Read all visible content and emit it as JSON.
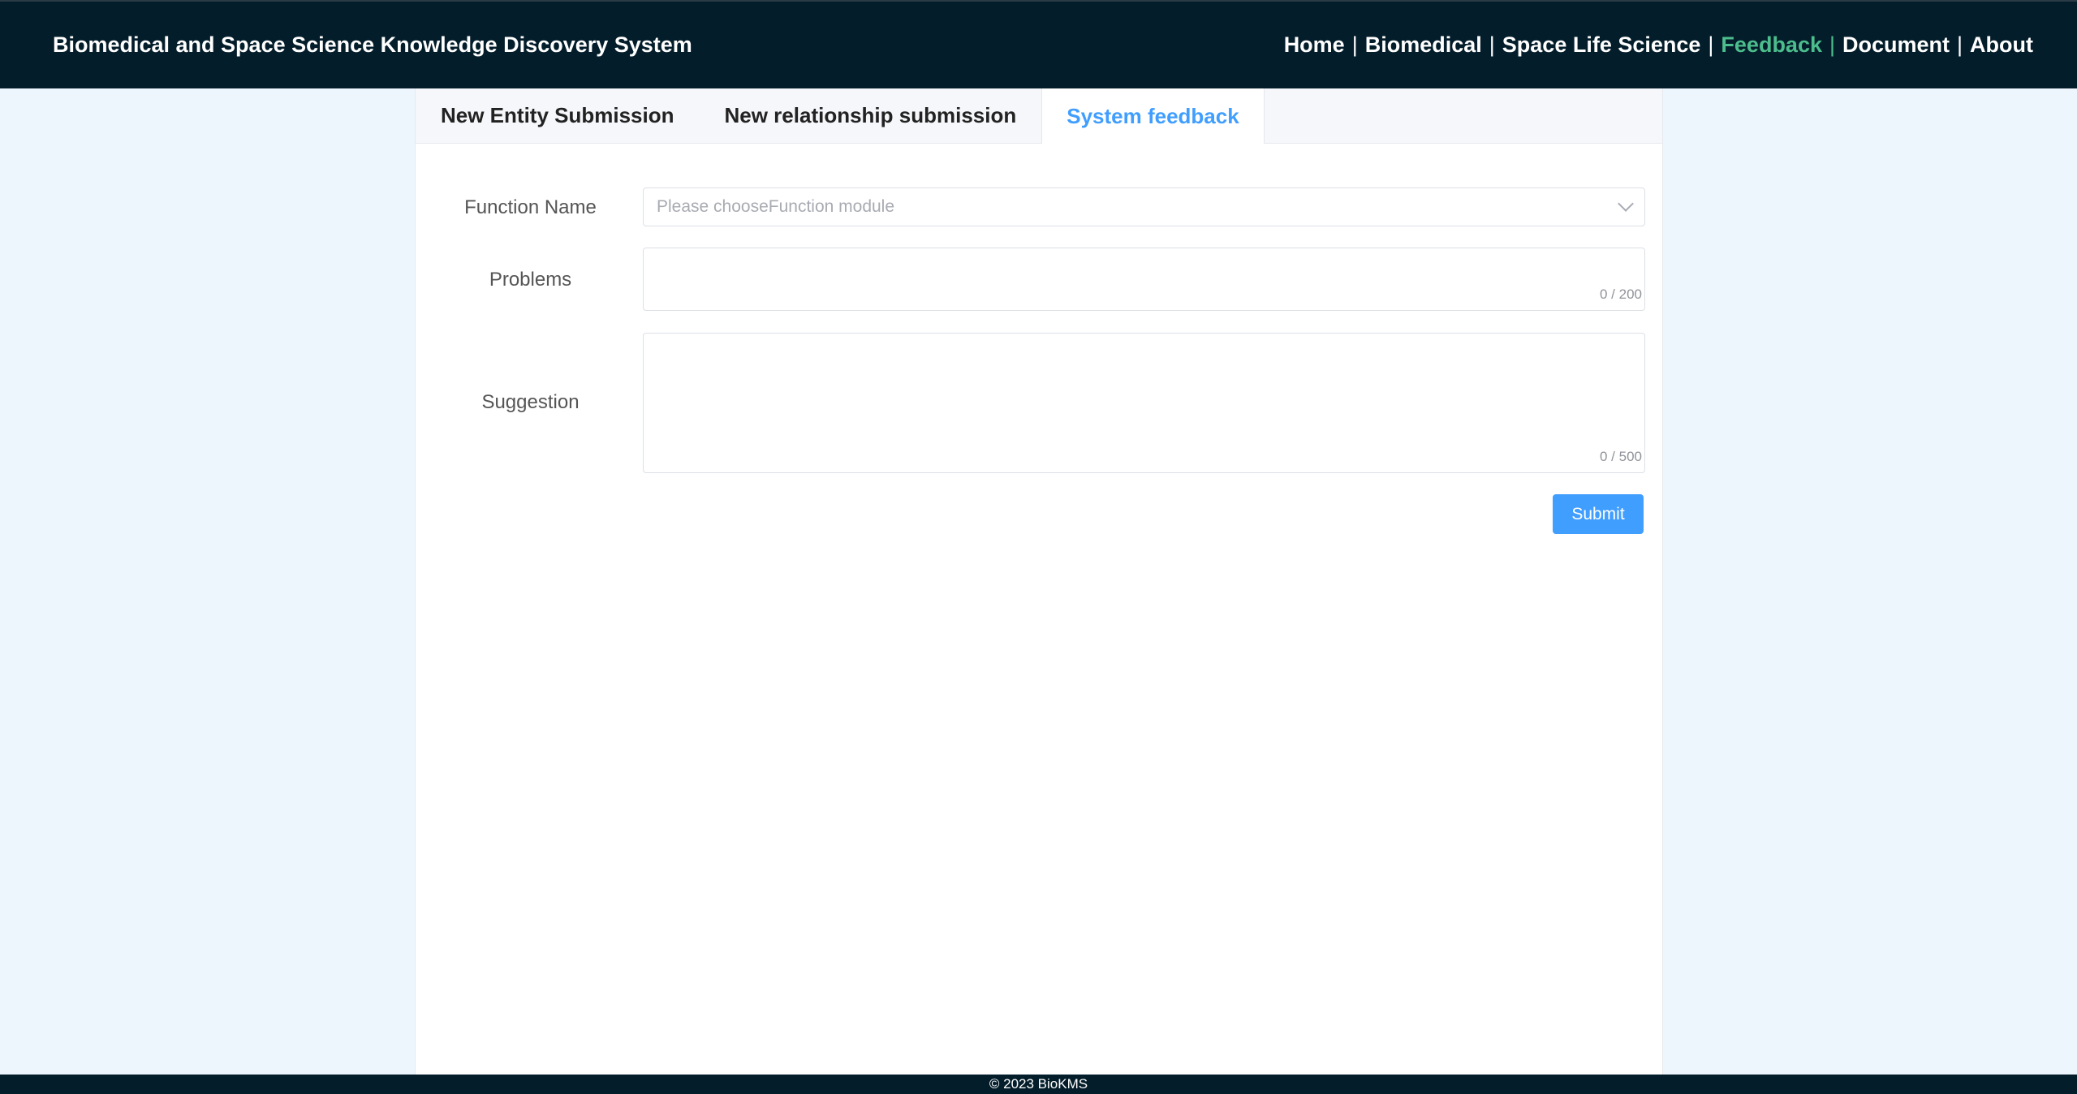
{
  "header": {
    "title": "Biomedical and Space Science Knowledge Discovery System",
    "nav": [
      {
        "label": "Home"
      },
      {
        "label": "Biomedical"
      },
      {
        "label": "Space Life Science"
      },
      {
        "label": "Feedback"
      },
      {
        "label": "Document"
      },
      {
        "label": "About"
      }
    ],
    "separator": "|",
    "active_nav": "Feedback",
    "colors": {
      "bar": "#041d2b",
      "active": "#4cbd8c"
    }
  },
  "tabs": [
    {
      "label": "New Entity Submission"
    },
    {
      "label": "New relationship submission"
    },
    {
      "label": "System feedback"
    }
  ],
  "active_tab": "System feedback",
  "form": {
    "function_name_label": "Function Name",
    "function_name_placeholder": "Please chooseFunction module",
    "problems_label": "Problems",
    "problems_value": "",
    "problems_counter": "0 / 200",
    "suggestion_label": "Suggestion",
    "suggestion_value": "",
    "suggestion_counter": "0 / 500",
    "submit_label": "Submit",
    "accent": "#409eff"
  },
  "footer": {
    "text": "© 2023 BioKMS"
  }
}
